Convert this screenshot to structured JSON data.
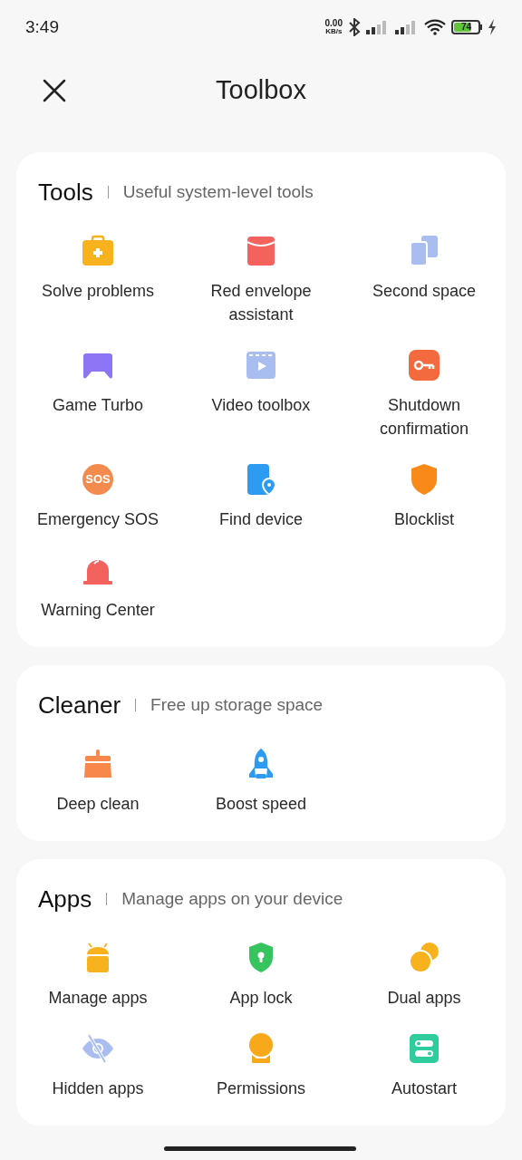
{
  "status_bar": {
    "time": "3:49",
    "speed_value": "0.00",
    "speed_unit": "KB/s",
    "battery": "74"
  },
  "header": {
    "title": "Toolbox"
  },
  "sections": [
    {
      "title": "Tools",
      "subtitle": "Useful system-level tools",
      "items": [
        {
          "label": "Solve problems"
        },
        {
          "label": "Red envelope assistant"
        },
        {
          "label": "Second space"
        },
        {
          "label": "Game Turbo"
        },
        {
          "label": "Video toolbox"
        },
        {
          "label": "Shutdown confirmation"
        },
        {
          "label": "Emergency SOS",
          "icon_text": "SOS"
        },
        {
          "label": "Find device"
        },
        {
          "label": "Blocklist"
        },
        {
          "label": "Warning Center"
        }
      ]
    },
    {
      "title": "Cleaner",
      "subtitle": "Free up storage space",
      "items": [
        {
          "label": "Deep clean"
        },
        {
          "label": "Boost speed"
        }
      ]
    },
    {
      "title": "Apps",
      "subtitle": "Manage apps on your device",
      "items": [
        {
          "label": "Manage apps"
        },
        {
          "label": "App lock"
        },
        {
          "label": "Dual apps"
        },
        {
          "label": "Hidden apps"
        },
        {
          "label": "Permissions"
        },
        {
          "label": "Autostart"
        }
      ]
    }
  ]
}
